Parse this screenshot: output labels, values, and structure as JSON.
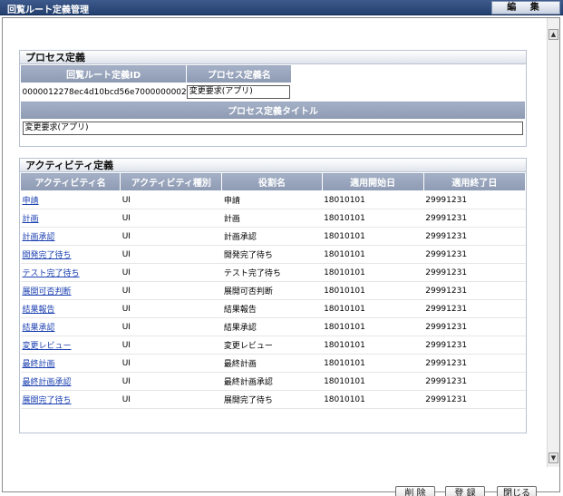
{
  "window": {
    "title": "回覧ルート定義管理",
    "edit_tab": "編 集"
  },
  "process": {
    "section_title": "プロセス定義",
    "route_id_header": "回覧ルート定義ID",
    "name_header": "プロセス定義名",
    "route_id": "0000012278ec4d10bcd56e7000000002",
    "name_value": "変更要求(アプリ)",
    "title_header": "プロセス定義タイトル",
    "title_value": "変更要求(アプリ)"
  },
  "activity": {
    "section_title": "アクティビティ定義",
    "headers": [
      "アクティビティ名",
      "アクティビティ種別",
      "役割名",
      "適用開始日",
      "適用終了日"
    ],
    "rows": [
      {
        "name": "申請",
        "type": "UI",
        "role": "申請",
        "start": "18010101",
        "end": "29991231"
      },
      {
        "name": "計画",
        "type": "UI",
        "role": "計画",
        "start": "18010101",
        "end": "29991231"
      },
      {
        "name": "計画承認",
        "type": "UI",
        "role": "計画承認",
        "start": "18010101",
        "end": "29991231"
      },
      {
        "name": "開発完了待ち",
        "type": "UI",
        "role": "開発完了待ち",
        "start": "18010101",
        "end": "29991231"
      },
      {
        "name": "テスト完了待ち",
        "type": "UI",
        "role": "テスト完了待ち",
        "start": "18010101",
        "end": "29991231"
      },
      {
        "name": "展開可否判断",
        "type": "UI",
        "role": "展開可否判断",
        "start": "18010101",
        "end": "29991231"
      },
      {
        "name": "結果報告",
        "type": "UI",
        "role": "結果報告",
        "start": "18010101",
        "end": "29991231"
      },
      {
        "name": "結果承認",
        "type": "UI",
        "role": "結果承認",
        "start": "18010101",
        "end": "29991231"
      },
      {
        "name": "変更レビュー",
        "type": "UI",
        "role": "変更レビュー",
        "start": "18010101",
        "end": "29991231"
      },
      {
        "name": "最終計画",
        "type": "UI",
        "role": "最終計画",
        "start": "18010101",
        "end": "29991231"
      },
      {
        "name": "最終計画承認",
        "type": "UI",
        "role": "最終計画承認",
        "start": "18010101",
        "end": "29991231"
      },
      {
        "name": "展開完了待ち",
        "type": "UI",
        "role": "展開完了待ち",
        "start": "18010101",
        "end": "29991231"
      }
    ]
  },
  "buttons": {
    "delete": "削 除",
    "register": "登 録",
    "close": "閉じる"
  }
}
